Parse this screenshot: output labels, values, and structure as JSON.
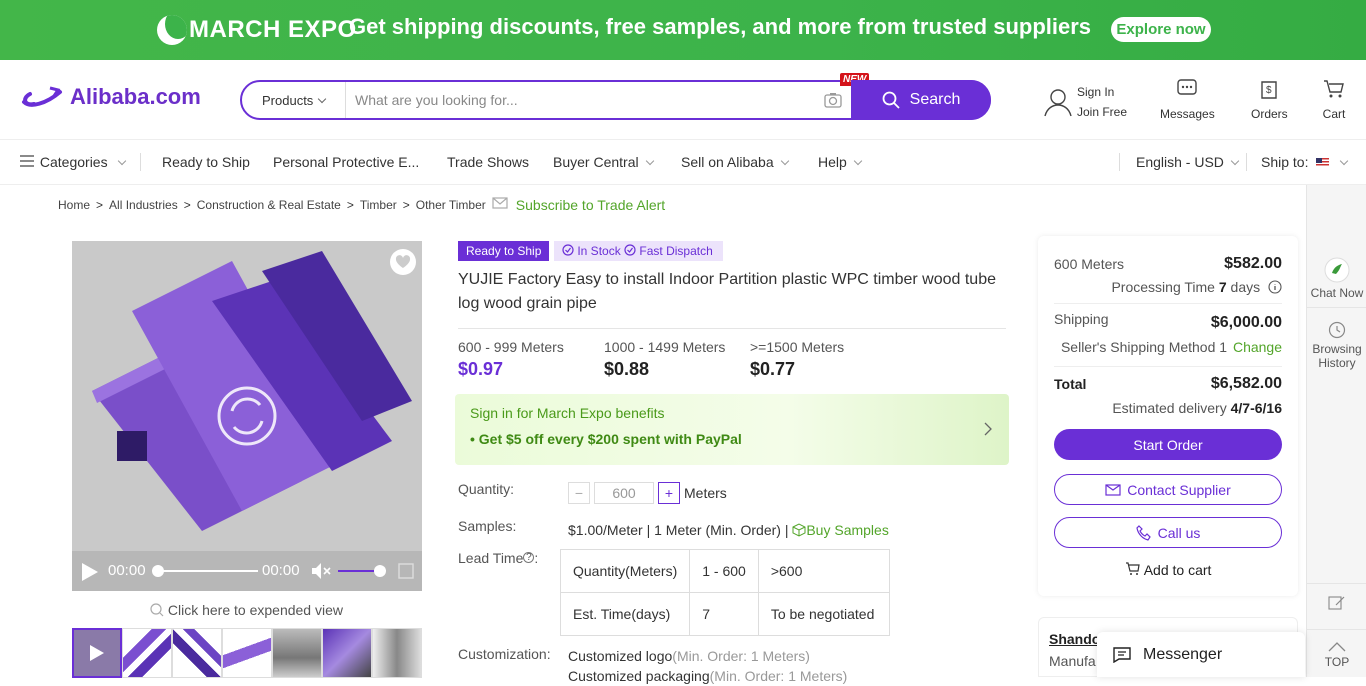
{
  "banner": {
    "brand": "MARCH EXPO",
    "message": "Get shipping discounts, free samples, and more from trusted suppliers",
    "cta": "Explore now"
  },
  "header": {
    "logo_text": "Alibaba.com",
    "search": {
      "category": "Products",
      "placeholder": "What are you looking for...",
      "new_tag": "NEW",
      "button": "Search"
    },
    "sign_in": "Sign In",
    "join": "Join Free",
    "messages": "Messages",
    "orders": "Orders",
    "cart": "Cart"
  },
  "nav": {
    "categories": "Categories",
    "items": [
      "Ready to Ship",
      "Personal Protective E...",
      "Trade Shows",
      "Buyer Central",
      "Sell on Alibaba",
      "Help"
    ],
    "language": "English - USD",
    "ship_to": "Ship to:"
  },
  "breadcrumb": {
    "items": [
      "Home",
      "All Industries",
      "Construction & Real Estate",
      "Timber",
      "Other Timber"
    ],
    "subscribe": "Subscribe to Trade Alert"
  },
  "media": {
    "time_current": "00:00",
    "time_total": "00:00",
    "expand": "Click here to expended view"
  },
  "product": {
    "tag_ready": "Ready to Ship",
    "tag_stock": "In Stock",
    "tag_dispatch": "Fast Dispatch",
    "title": "YUJIE Factory Easy to install Indoor Partition plastic WPC timber wood tube log wood grain pipe",
    "tiers": [
      {
        "range": "600 - 999 Meters",
        "price": "$0.97"
      },
      {
        "range": "1000 - 1499 Meters",
        "price": "$0.88"
      },
      {
        "range": ">=1500 Meters",
        "price": "$0.77"
      }
    ],
    "promo_title": "Sign in for March Expo benefits",
    "promo_detail": "• Get $5 off every $200 spent with PayPal",
    "quantity_label": "Quantity:",
    "quantity_value": "600",
    "quantity_unit": "Meters",
    "samples_label": "Samples:",
    "samples_text": "$1.00/Meter | 1 Meter (Min. Order) |",
    "buy_samples": "Buy Samples",
    "lead_time_label": "Lead Time",
    "lead_table": {
      "row1": [
        "Quantity(Meters)",
        "1 - 600",
        ">600"
      ],
      "row2": [
        "Est. Time(days)",
        "7",
        "To be negotiated"
      ]
    },
    "customization_label": "Customization:",
    "custom1": "Customized logo",
    "custom1_note": "(Min. Order: 1 Meters)",
    "custom2": "Customized packaging",
    "custom2_note": "(Min. Order: 1 Meters)"
  },
  "order": {
    "qty": "600 Meters",
    "qty_price": "$582.00",
    "processing_label": "Processing Time",
    "processing_value": "7",
    "processing_unit": "days",
    "shipping_label": "Shipping",
    "shipping_price": "$6,000.00",
    "method": "Seller's Shipping Method 1",
    "change": "Change",
    "total_label": "Total",
    "total_price": "$6,582.00",
    "delivery_label": "Estimated delivery",
    "delivery_value": "4/7-6/16",
    "start_order": "Start Order",
    "contact": "Contact Supplier",
    "call": "Call us",
    "add_cart": "Add to cart"
  },
  "supplier": {
    "name": "Shando",
    "type": "Manufa"
  },
  "rail": {
    "chat": "Chat Now",
    "browsing": "Browsing History",
    "top": "TOP"
  },
  "messenger": "Messenger",
  "colors": {
    "banner": "#3cb34a",
    "brand": "#6a2fd6",
    "promo_green": "#4a9a1a"
  }
}
